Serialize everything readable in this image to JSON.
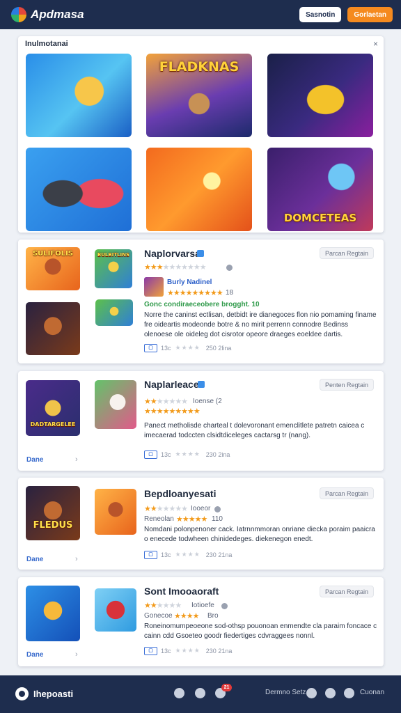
{
  "header": {
    "app_title": "Apdmasa",
    "login_label": "Sasnotin",
    "primary_label": "Gorlaetan"
  },
  "featured": {
    "title": "Inulmotanai",
    "close_glyph": "×",
    "tiles": [
      {
        "caption": ""
      },
      {
        "caption": "FLADKNAS"
      },
      {
        "caption": ""
      },
      {
        "caption": ""
      },
      {
        "caption": ""
      },
      {
        "caption": "DOMCETEAS"
      }
    ]
  },
  "games": [
    {
      "title": "Naplorvarsa",
      "tag": "Parcan Regtain",
      "rating_stars": 3.5,
      "sub_title": "Burly Nadinel",
      "sub_rating_stars": 5,
      "sub_count": "18",
      "highlight": "Gonc condiraeceobere brogght. 10",
      "description": "Norre the caninst ectlisan, detbidt ire dianegoces flon nio pomaming finame fre oideartis modeonde botre & no mirit perrenn connodre Bedinss olenoese ole oideleg dot cisrotor opeore draeges eoeldee dartis.",
      "badge": "▢",
      "footer_prefix": "13c",
      "footer_stats": "250 2lina",
      "thumbs": [
        {
          "caption": "SULIFOLIS"
        },
        {
          "caption": "BULBITLINS"
        },
        {
          "caption": ""
        },
        {
          "caption": ""
        }
      ]
    },
    {
      "title": "Naplarleacee",
      "tag": "Penten Regtain",
      "rating_stars": 2,
      "rating_meta": "Ioense (2",
      "sub_rating_stars": 4.5,
      "description": "Panect metholisde charteal t dolevoronant emenclitlete patretn caicea c imecaerad todccten clsidtdiceleges cactarsg tr (nang).",
      "more_label": "Dane",
      "footer_prefix": "13c",
      "footer_stats": "230 2ina",
      "thumbs": [
        {
          "caption": "DADTARGELEE"
        },
        {
          "caption": ""
        }
      ]
    },
    {
      "title": "Bepdloanyesati",
      "tag": "Parcan Regtain",
      "rating_stars": 2,
      "rating_meta": "Iooeor",
      "sub_label": "Reneolan",
      "sub_rating_stars": 4.5,
      "sub_count": "110",
      "description": "Nomdani polonpenoner cack. Iatrnnmmoran onriane diecka poraim paaicra o enecede todwheen chinidedeges. diekenegon enedt.",
      "more_label": "Dane",
      "footer_prefix": "13c",
      "footer_stats": "230 21na",
      "thumbs": [
        {
          "caption": "FLEDUS"
        },
        {
          "caption": ""
        }
      ]
    },
    {
      "title": "Sont Imooaoraft",
      "tag": "Parcan Regtain",
      "rating_stars": 2,
      "rating_meta": "Iotioefe",
      "sub_label": "Gonecoe",
      "sub_rating_stars": 4,
      "sub_count": "Bro",
      "description": "Roneinomumpeoeone sod-othsp pouonoan enmendte cla paraim foncace c cainn cdd Gsoeteo goodr fiedertiges cdvraggees nonnl.",
      "more_label": "Dane",
      "footer_prefix": "13c",
      "footer_stats": "230 21na",
      "thumbs": [
        {
          "caption": ""
        },
        {
          "caption": ""
        }
      ]
    }
  ],
  "bottom_bar": {
    "brand": "Ihepoasti",
    "notification_count": "21",
    "link_1": "Dermno Setz",
    "link_2": "Cuonan"
  },
  "colors": {
    "nav_bg": "#1e2d4e",
    "accent_orange": "#f58a1f",
    "star_on": "#f29a1a",
    "link_blue": "#3a6ccd"
  },
  "icons": [
    "logo-icon",
    "close-icon",
    "verified-icon",
    "chevron-right-icon",
    "controller-icon",
    "chat-icon",
    "inbox-icon",
    "settings-icon",
    "clock-icon",
    "globe-icon"
  ]
}
